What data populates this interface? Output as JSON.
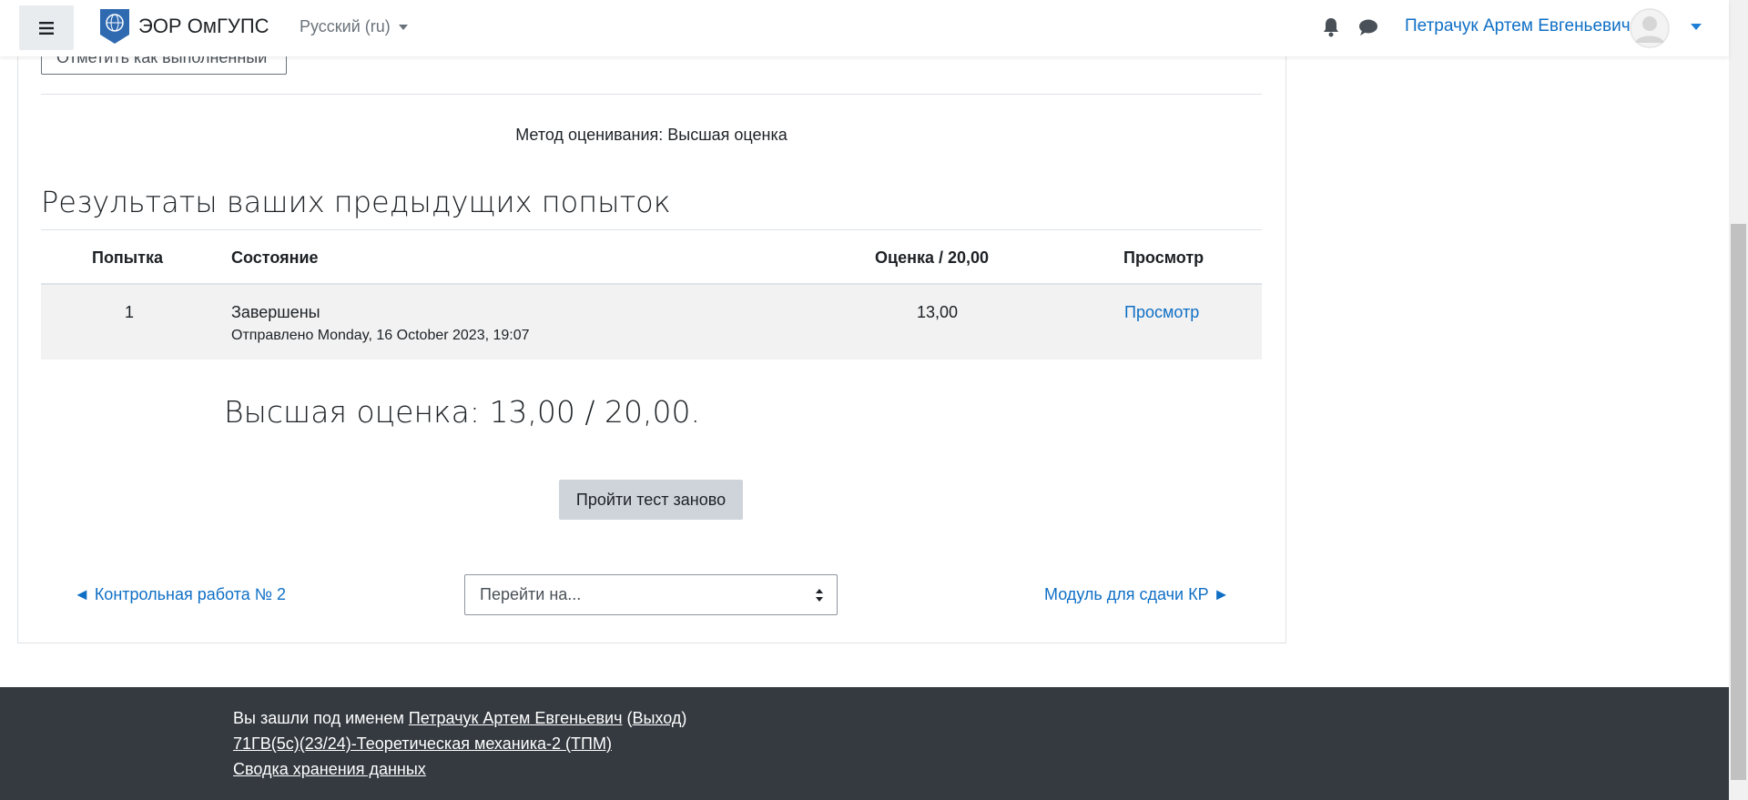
{
  "navbar": {
    "site_name": "ЭОР ОмГУПС",
    "language": "Русский (ru)",
    "user_name": "Петрачук Артем Евгеньевич"
  },
  "activity": {
    "mark_complete_label": "Отметить как выполненный",
    "grading_method": "Метод оценивания: Высшая оценка"
  },
  "attempts": {
    "title": "Результаты ваших предыдущих попыток",
    "columns": [
      "Попытка",
      "Состояние",
      "Оценка / 20,00",
      "Просмотр"
    ],
    "rows": [
      {
        "attempt": "1",
        "state": "Завершены",
        "submitted": "Отправлено Monday, 16 October 2023, 19:07",
        "grade": "13,00",
        "review": "Просмотр"
      }
    ]
  },
  "highest_grade": "Высшая оценка: 13,00 / 20,00.",
  "retake_button": "Пройти тест заново",
  "navigation": {
    "prev": "◄ Контрольная работа № 2",
    "jump_placeholder": "Перейти на...",
    "next": "Модуль для сдачи КР ►"
  },
  "footer": {
    "logged_in_prefix": "Вы зашли под именем",
    "user_link": "Петрачук Артем Евгеньевич",
    "open_paren": "(",
    "logout": "Выход",
    "close_paren": ")",
    "course_link": "71ГВ(5с)(23/24)-Теоретическая механика-2 (ТПМ)",
    "data_retention": "Сводка хранения данных"
  },
  "colors": {
    "link": "#0f6fc5",
    "footer_bg": "#343a40",
    "row_bg": "#f2f2f2",
    "button_bg": "#ced4da"
  },
  "icons": [
    "menu-icon",
    "site-logo-icon",
    "bell-icon",
    "chat-icon",
    "avatar-icon",
    "select-arrows-icon"
  ]
}
